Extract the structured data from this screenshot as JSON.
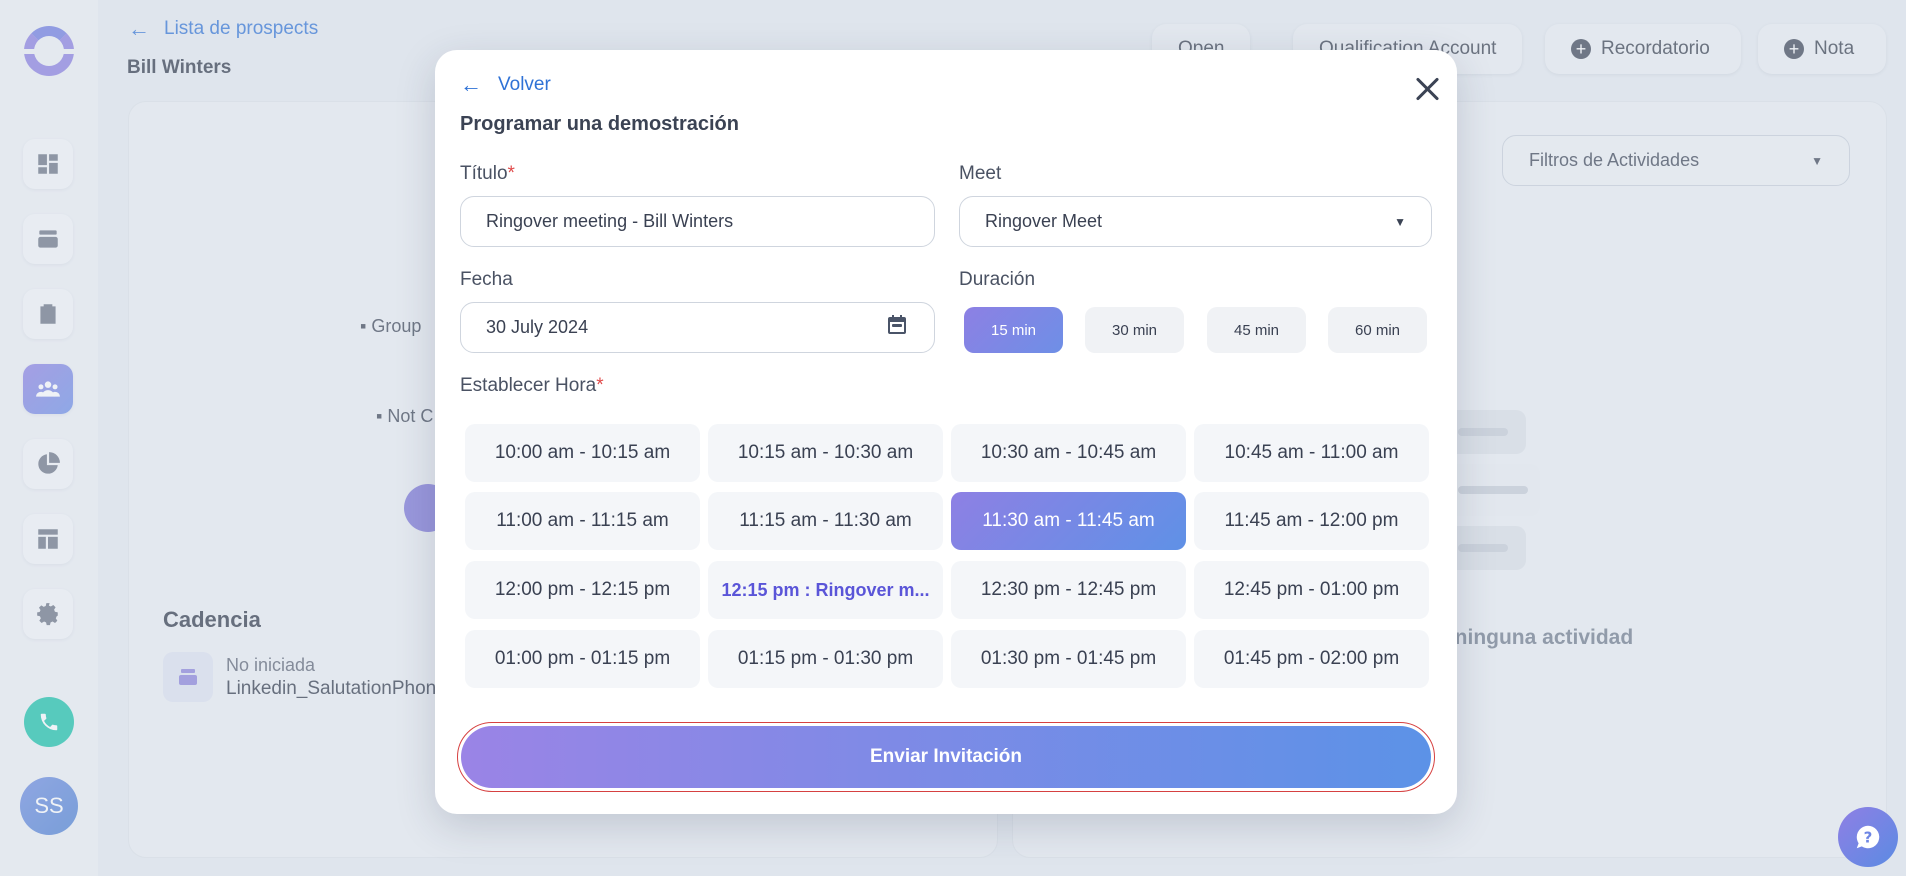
{
  "sidebar": {
    "items": [
      {
        "name": "dashboard-icon"
      },
      {
        "name": "cadence-stack-icon"
      },
      {
        "name": "tasks-clipboard-icon"
      },
      {
        "name": "people-icon"
      },
      {
        "name": "pie-chart-icon"
      },
      {
        "name": "layout-icon"
      },
      {
        "name": "gear-icon"
      }
    ],
    "active_index": 3,
    "avatar_initials": "SS"
  },
  "header": {
    "back_label": "Lista de prospects",
    "prospect_name": "Bill Winters",
    "buttons": {
      "open": "Open",
      "qualification": "Qualification Account",
      "reminder": "Recordatorio",
      "note": "Nota"
    }
  },
  "background": {
    "group_text": "Group",
    "not_text": "Not C",
    "cadencia_title": "Cadencia",
    "cadence_status": "No iniciada",
    "cadence_name": "Linkedin_SalutationPhon",
    "activity_filter": "Filtros de Actividades",
    "empty_activity": "o ninguna actividad"
  },
  "modal": {
    "back_label": "Volver",
    "title": "Programar una demostración",
    "title_label": "Título",
    "title_value": "Ringover meeting - Bill Winters",
    "meet_label": "Meet",
    "meet_value": "Ringover Meet",
    "date_label": "Fecha",
    "date_value": "30 July 2024",
    "duration_label": "Duración",
    "durations": [
      "15 min",
      "30 min",
      "45 min",
      "60 min"
    ],
    "selected_duration": "15 min",
    "time_label": "Establecer Hora",
    "slots": [
      "10:00 am - 10:15 am",
      "10:15 am - 10:30 am",
      "10:30 am - 10:45 am",
      "10:45 am - 11:00 am",
      "11:00 am - 11:15 am",
      "11:15 am - 11:30 am",
      "11:30 am - 11:45 am",
      "11:45 am - 12:00 pm",
      "12:00 pm - 12:15 pm",
      "12:15 pm : Ringover m...",
      "12:30 pm - 12:45 pm",
      "12:45 pm - 01:00 pm",
      "01:00 pm - 01:15 pm",
      "01:15 pm - 01:30 pm",
      "01:30 pm - 01:45 pm",
      "01:45 pm - 02:00 pm"
    ],
    "selected_slot": "11:30 am - 11:45 am",
    "booked_slot": "12:15 pm : Ringover m...",
    "submit_label": "Enviar Invitación"
  },
  "colors": {
    "accent": "#2f72d6",
    "primary_gradient_start": "#9a84e6",
    "primary_gradient_end": "#5c92e7",
    "required": "#e04a4a",
    "call_green": "#16c2a8"
  }
}
